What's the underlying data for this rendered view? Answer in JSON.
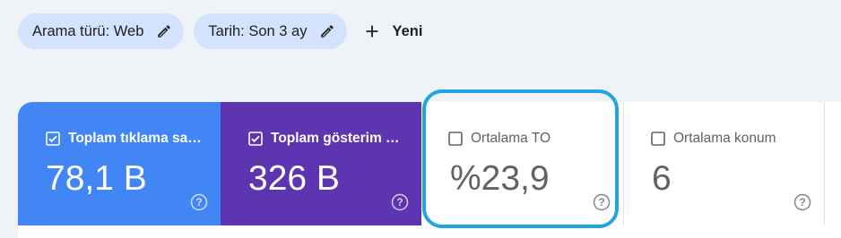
{
  "filters": {
    "chips": [
      {
        "label": "Arama türü: Web",
        "icon": "pencil-icon"
      },
      {
        "label": "Tarih: Son 3 ay",
        "icon": "pencil-icon"
      }
    ],
    "new_button": {
      "label": "Yeni",
      "icon": "plus-icon"
    }
  },
  "metrics": [
    {
      "label": "Toplam tıklama sayısı",
      "value": "78,1 B",
      "checked": true,
      "color": "#4285f4"
    },
    {
      "label": "Toplam gösterim sayısı",
      "value": "326 B",
      "checked": true,
      "color": "#5e35b1"
    },
    {
      "label": "Ortalama TO",
      "value": "%23,9",
      "checked": false,
      "color": "#ffffff"
    },
    {
      "label": "Ortalama konum",
      "value": "6",
      "checked": false,
      "color": "#ffffff"
    }
  ],
  "colors": {
    "highlight": "#1fa6e0",
    "background": "#eff3f8",
    "chip": "#d3e3fd"
  }
}
